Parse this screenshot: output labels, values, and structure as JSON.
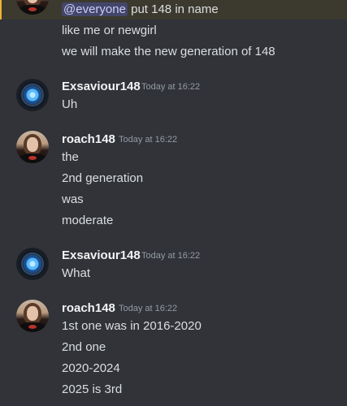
{
  "messages": [
    {
      "author": "",
      "timestamp": "",
      "avatar": "girl-avatar",
      "lines": [
        {
          "mention": "@everyone",
          "text": " put 148 in name"
        },
        {
          "text": "like me or newgirl"
        },
        {
          "text": "we will make the new generation of 148"
        }
      ]
    },
    {
      "author": "Exsaviour148",
      "timestamp": "Today at 16:22",
      "avatar": "robot-avatar",
      "lines": [
        {
          "text": "Uh"
        }
      ]
    },
    {
      "author": "roach148",
      "timestamp": "Today at 16:22",
      "avatar": "girl-avatar",
      "lines": [
        {
          "text": "the"
        },
        {
          "text": "2nd generation"
        },
        {
          "text": "was"
        },
        {
          "text": "moderate"
        }
      ]
    },
    {
      "author": "Exsaviour148",
      "timestamp": "Today at 16:22",
      "avatar": "robot-avatar",
      "lines": [
        {
          "text": "What"
        }
      ]
    },
    {
      "author": "roach148",
      "timestamp": "Today at 16:22",
      "avatar": "girl-avatar",
      "lines": [
        {
          "text": "1st one was in 2016-2020"
        },
        {
          "text": "2nd one"
        },
        {
          "text": "2020-2024"
        },
        {
          "text": "2025 is 3rd"
        }
      ]
    }
  ],
  "colors": {
    "background": "#313338",
    "mention_highlight": "#3c3a2f",
    "mention_bar": "#f0b232",
    "mention_pill": "#5865f2"
  }
}
